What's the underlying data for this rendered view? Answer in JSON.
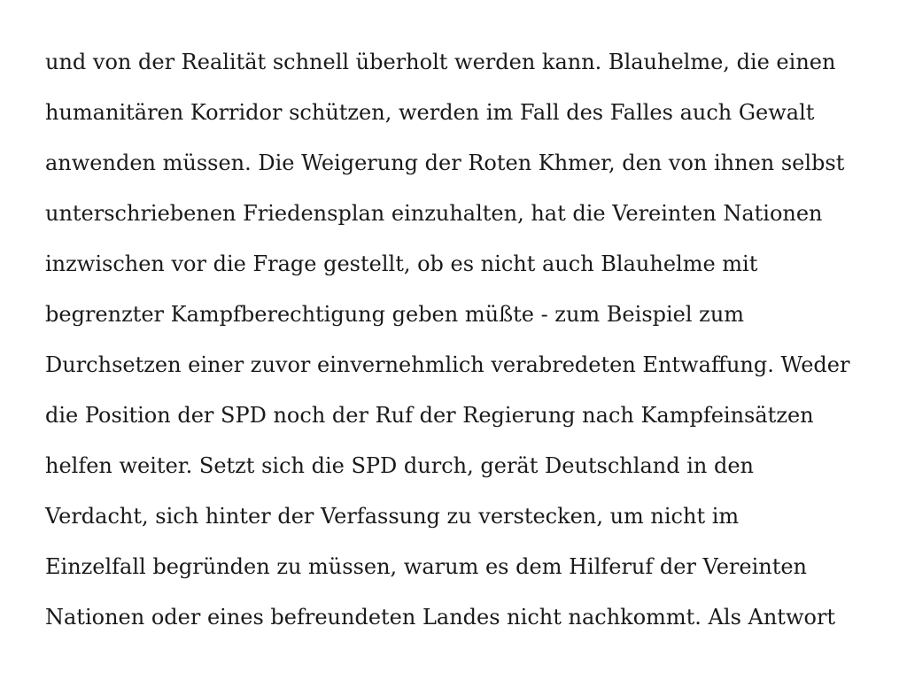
{
  "document": {
    "lines": [
      "und von der Realität schnell überholt werden kann. Blauhelme, die einen",
      "humanitären Korridor schützen, werden im Fall des Falles auch Gewalt",
      "anwenden müssen. Die Weigerung der Roten Khmer, den von ihnen selbst",
      "unterschriebenen Friedensplan einzuhalten, hat die Vereinten Nationen",
      "inzwischen vor die Frage gestellt, ob es nicht auch Blauhelme mit",
      "begrenzter Kampfberechtigung geben müßte - zum Beispiel zum",
      "Durchsetzen einer zuvor einvernehmlich verabredeten Entwaffung. Weder",
      "die Position der SPD noch der Ruf der Regierung nach Kampfeinsätzen",
      "helfen weiter. Setzt sich die SPD durch, gerät Deutschland in den",
      "Verdacht, sich hinter der Verfassung zu verstecken, um nicht im",
      "Einzelfall begründen zu müssen, warum es dem Hilferuf der Vereinten",
      "Nationen oder eines befreundeten Landes nicht nachkommt. Als Antwort"
    ]
  }
}
